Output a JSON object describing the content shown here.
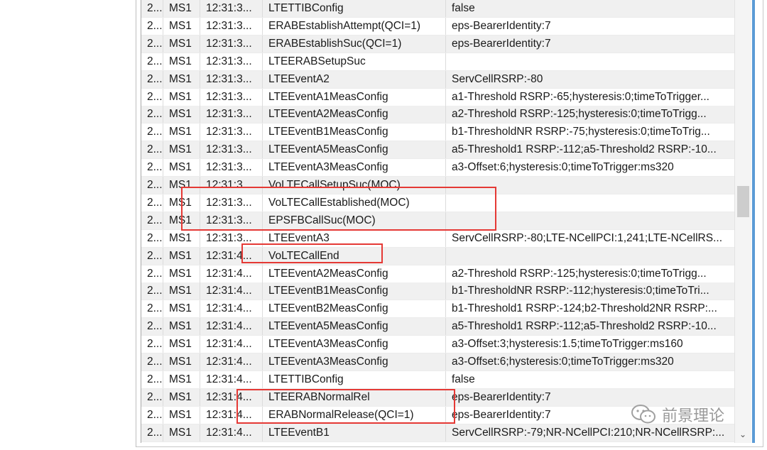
{
  "rows": [
    {
      "c0": "2...",
      "c1": "MS1",
      "c2": "12:31:3...",
      "c3": "LTETTIBConfig",
      "c4": "false"
    },
    {
      "c0": "2...",
      "c1": "MS1",
      "c2": "12:31:3...",
      "c3": "ERABEstablishAttempt(QCI=1)",
      "c4": "eps-BearerIdentity:7"
    },
    {
      "c0": "2...",
      "c1": "MS1",
      "c2": "12:31:3...",
      "c3": "ERABEstablishSuc(QCI=1)",
      "c4": "eps-BearerIdentity:7"
    },
    {
      "c0": "2...",
      "c1": "MS1",
      "c2": "12:31:3...",
      "c3": "LTEERABSetupSuc",
      "c4": ""
    },
    {
      "c0": "2...",
      "c1": "MS1",
      "c2": "12:31:3...",
      "c3": "LTEEventA2",
      "c4": "ServCellRSRP:-80"
    },
    {
      "c0": "2...",
      "c1": "MS1",
      "c2": "12:31:3...",
      "c3": "LTEEventA1MeasConfig",
      "c4": "a1-Threshold RSRP:-65;hysteresis:0;timeToTrigger..."
    },
    {
      "c0": "2...",
      "c1": "MS1",
      "c2": "12:31:3...",
      "c3": "LTEEventA2MeasConfig",
      "c4": "a2-Threshold RSRP:-125;hysteresis:0;timeToTrigg..."
    },
    {
      "c0": "2...",
      "c1": "MS1",
      "c2": "12:31:3...",
      "c3": "LTEEventB1MeasConfig",
      "c4": "b1-ThresholdNR RSRP:-75;hysteresis:0;timeToTrig..."
    },
    {
      "c0": "2...",
      "c1": "MS1",
      "c2": "12:31:3...",
      "c3": "LTEEventA5MeasConfig",
      "c4": "a5-Threshold1 RSRP:-112;a5-Threshold2 RSRP:-10..."
    },
    {
      "c0": "2...",
      "c1": "MS1",
      "c2": "12:31:3...",
      "c3": "LTEEventA3MeasConfig",
      "c4": "a3-Offset:6;hysteresis:0;timeToTrigger:ms320"
    },
    {
      "c0": "2...",
      "c1": "MS1",
      "c2": "12:31:3...",
      "c3": "VoLTECallSetupSuc(MOC)",
      "c4": ""
    },
    {
      "c0": "2...",
      "c1": "MS1",
      "c2": "12:31:3...",
      "c3": "VoLTECallEstablished(MOC)",
      "c4": ""
    },
    {
      "c0": "2...",
      "c1": "MS1",
      "c2": "12:31:3...",
      "c3": "EPSFBCallSuc(MOC)",
      "c4": ""
    },
    {
      "c0": "2...",
      "c1": "MS1",
      "c2": "12:31:3...",
      "c3": "LTEEventA3",
      "c4": "ServCellRSRP:-80;LTE-NCellPCI:1,241;LTE-NCellRS..."
    },
    {
      "c0": "2...",
      "c1": "MS1",
      "c2": "12:31:4...",
      "c3": "VoLTECallEnd",
      "c4": ""
    },
    {
      "c0": "2...",
      "c1": "MS1",
      "c2": "12:31:4...",
      "c3": "LTEEventA2MeasConfig",
      "c4": "a2-Threshold RSRP:-125;hysteresis:0;timeToTrigg..."
    },
    {
      "c0": "2...",
      "c1": "MS1",
      "c2": "12:31:4...",
      "c3": "LTEEventB1MeasConfig",
      "c4": "b1-ThresholdNR RSRP:-112;hysteresis:0;timeToTri..."
    },
    {
      "c0": "2...",
      "c1": "MS1",
      "c2": "12:31:4...",
      "c3": "LTEEventB2MeasConfig",
      "c4": "b1-Threshold1 RSRP:-124;b2-Threshold2NR RSRP:..."
    },
    {
      "c0": "2...",
      "c1": "MS1",
      "c2": "12:31:4...",
      "c3": "LTEEventA5MeasConfig",
      "c4": "a5-Threshold1 RSRP:-112;a5-Threshold2 RSRP:-10..."
    },
    {
      "c0": "2...",
      "c1": "MS1",
      "c2": "12:31:4...",
      "c3": "LTEEventA3MeasConfig",
      "c4": "a3-Offset:3;hysteresis:1.5;timeToTrigger:ms160"
    },
    {
      "c0": "2...",
      "c1": "MS1",
      "c2": "12:31:4...",
      "c3": "LTEEventA3MeasConfig",
      "c4": "a3-Offset:6;hysteresis:0;timeToTrigger:ms320"
    },
    {
      "c0": "2...",
      "c1": "MS1",
      "c2": "12:31:4...",
      "c3": "LTETTIBConfig",
      "c4": "false"
    },
    {
      "c0": "2...",
      "c1": "MS1",
      "c2": "12:31:4...",
      "c3": "LTEERABNormalRel",
      "c4": "eps-BearerIdentity:7"
    },
    {
      "c0": "2...",
      "c1": "MS1",
      "c2": "12:31:4...",
      "c3": "ERABNormalRelease(QCI=1)",
      "c4": "eps-BearerIdentity:7"
    },
    {
      "c0": "2...",
      "c1": "MS1",
      "c2": "12:31:4...",
      "c3": "LTEEventB1",
      "c4": "ServCellRSRP:-79;NR-NCellPCI:210;NR-NCellRSRP:..."
    }
  ],
  "scrollbar": {
    "down_arrow": "⌄"
  },
  "watermark": {
    "text": "前景理论"
  },
  "colors": {
    "highlight": "#e53935",
    "row_alt": "#f0f0f0",
    "accent": "#5b9bd5"
  }
}
